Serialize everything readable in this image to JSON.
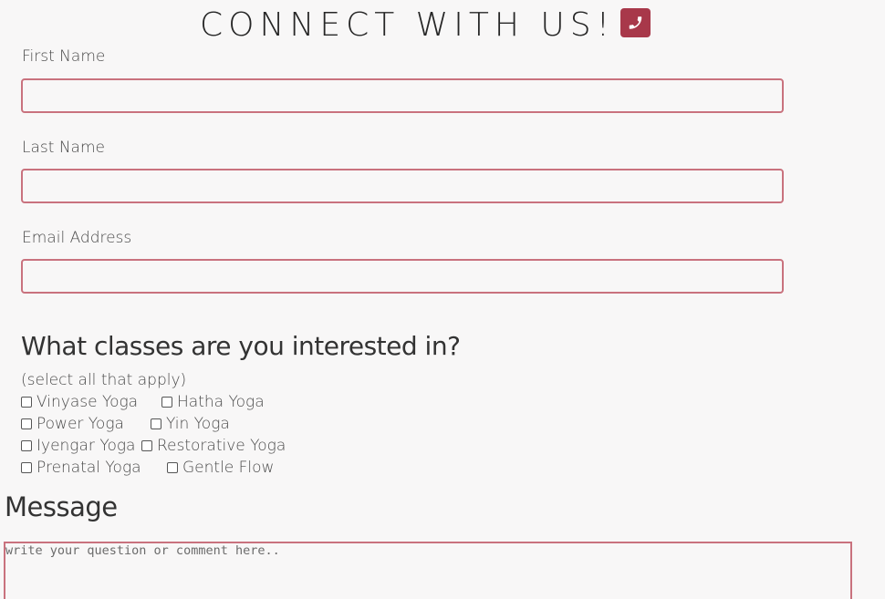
{
  "header": {
    "title": "CONNECT WITH US!",
    "icon": "phone-icon",
    "icon_color": "#a8384a"
  },
  "form": {
    "first_name_label": "First Name",
    "first_name_value": "",
    "last_name_label": "Last Name",
    "last_name_value": "",
    "email_label": "Email Address",
    "email_value": "",
    "field_border_color": "#c9727e"
  },
  "classes": {
    "heading": "What classes are you interested in?",
    "subheading": "(select all that apply)",
    "options": [
      {
        "label": "Vinyase Yoga",
        "checked": false
      },
      {
        "label": "Hatha Yoga",
        "checked": false
      },
      {
        "label": "Power Yoga",
        "checked": false
      },
      {
        "label": "Yin Yoga",
        "checked": false
      },
      {
        "label": "Iyengar Yoga",
        "checked": false
      },
      {
        "label": "Restorative Yoga",
        "checked": false
      },
      {
        "label": "Prenatal Yoga",
        "checked": false
      },
      {
        "label": "Gentle Flow",
        "checked": false
      }
    ]
  },
  "message": {
    "heading": "Message",
    "placeholder": "write your question or comment here..",
    "value": ""
  }
}
